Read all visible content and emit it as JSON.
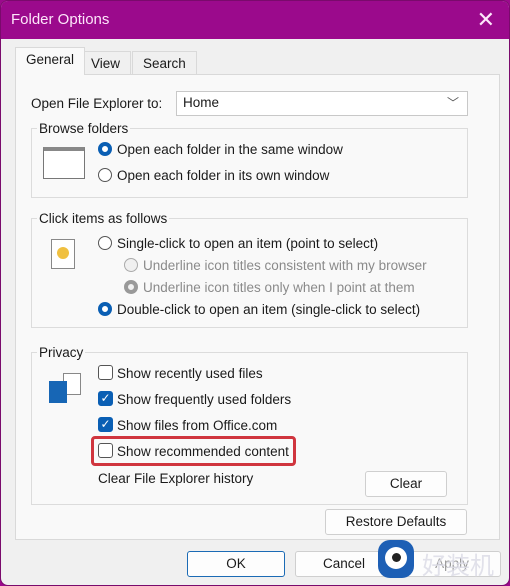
{
  "window": {
    "title": "Folder Options"
  },
  "tabs": [
    {
      "label": "General"
    },
    {
      "label": "View"
    },
    {
      "label": "Search"
    }
  ],
  "open_to": {
    "label": "Open File Explorer to:",
    "value": "Home"
  },
  "browse": {
    "title": "Browse folders",
    "options": [
      {
        "label": "Open each folder in the same window",
        "selected": true
      },
      {
        "label": "Open each folder in its own window",
        "selected": false
      }
    ]
  },
  "click": {
    "title": "Click items as follows",
    "single": "Single-click to open an item (point to select)",
    "sub1": "Underline icon titles consistent with my browser",
    "sub2": "Underline icon titles only when I point at them",
    "double": "Double-click to open an item (single-click to select)",
    "selected": "double"
  },
  "privacy": {
    "title": "Privacy",
    "items": [
      {
        "label": "Show recently used files",
        "checked": false
      },
      {
        "label": "Show frequently used folders",
        "checked": true
      },
      {
        "label": "Show files from Office.com",
        "checked": true
      },
      {
        "label": "Show recommended content",
        "checked": false
      }
    ],
    "clear_label": "Clear File Explorer history",
    "clear_button": "Clear"
  },
  "buttons": {
    "restore": "Restore Defaults",
    "ok": "OK",
    "cancel": "Cancel",
    "apply": "Apply"
  },
  "watermark": "好装机",
  "colors": {
    "titlebar": "#9b0a8c",
    "accent": "#0a5fb4",
    "highlight": "#d0353e"
  }
}
